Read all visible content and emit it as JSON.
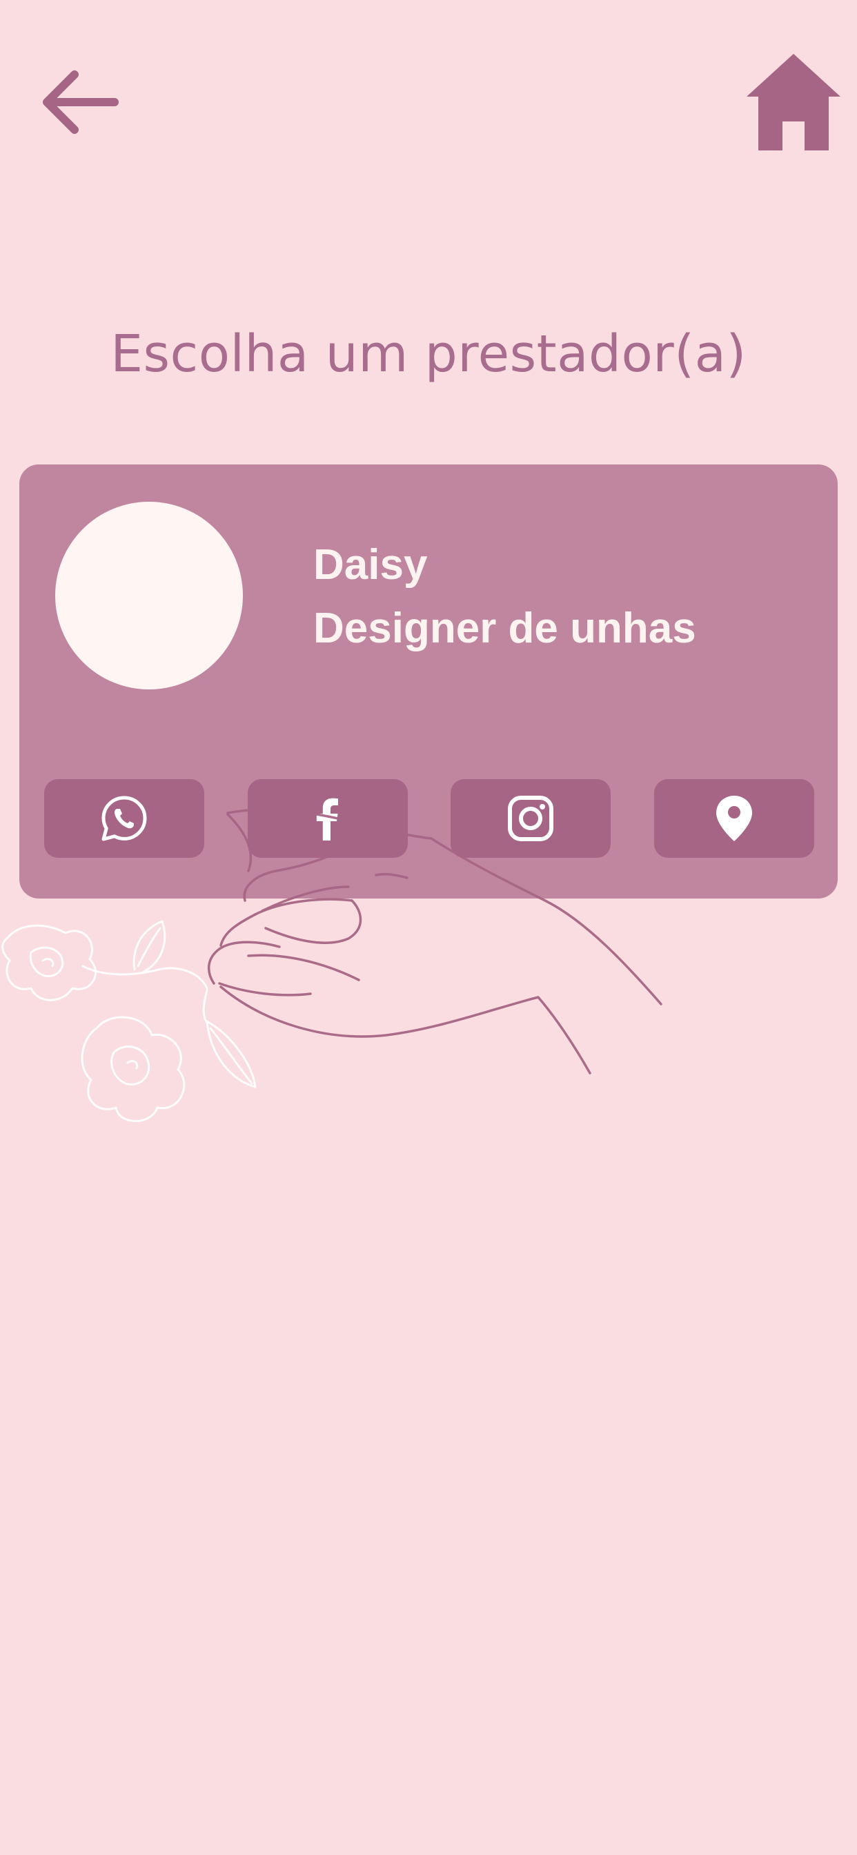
{
  "header": {
    "back_icon": "arrow-left-icon",
    "home_icon": "home-icon"
  },
  "page": {
    "title": "Escolha um prestador(a)"
  },
  "provider_card": {
    "name": "Daisy",
    "role": "Designer de unhas",
    "actions": [
      {
        "icon": "whatsapp-icon"
      },
      {
        "icon": "facebook-icon"
      },
      {
        "icon": "instagram-icon"
      },
      {
        "icon": "location-pin-icon"
      }
    ]
  },
  "colors": {
    "background": "#fadde1",
    "accent": "#a66584",
    "card": "#c0869f",
    "title_text": "#a86c8e",
    "card_text": "#fdf3f1",
    "avatar": "#fff5f2"
  }
}
